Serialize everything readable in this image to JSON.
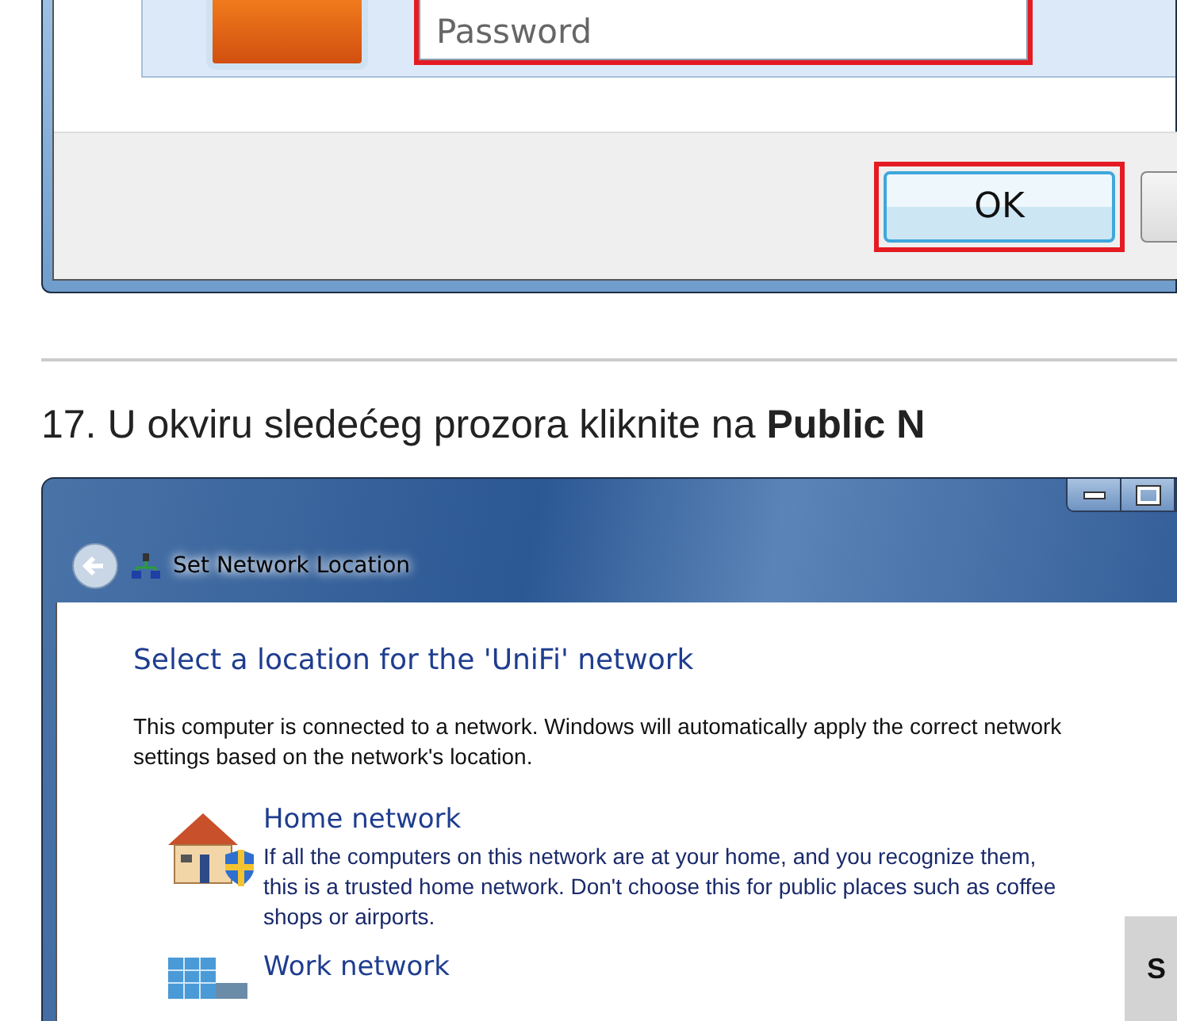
{
  "dialog1": {
    "password_field": {
      "placeholder": "Password",
      "highlighted": true
    },
    "buttons": [
      {
        "label": "OK",
        "highlighted": true
      }
    ]
  },
  "step": {
    "text": "17. U okviru sledećeg prozora kliknite na **Public N**"
  },
  "dialog2": {
    "title": "Set Network Location",
    "heading": "Select a location for the 'UniFi' network",
    "intro": "This computer is connected to a network. Windows will automatically apply the correct network settings based on the network's location.",
    "options": [
      {
        "kind": "home",
        "title": "Home network",
        "description": "If all the computers on this network are at your home, and you recognize them, this is a trusted home network.  Don't choose this for public places such as coffee shops or airports."
      },
      {
        "kind": "work",
        "title": "Work network"
      }
    ]
  },
  "share_tab": {
    "label": "S"
  }
}
